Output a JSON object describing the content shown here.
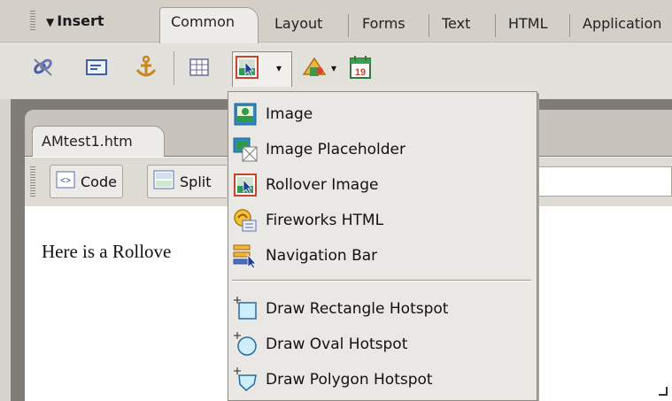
{
  "insert_bar": {
    "title": "Insert",
    "tabs": [
      "Common",
      "Layout",
      "Forms",
      "Text",
      "HTML",
      "Application"
    ],
    "active_tab": "Common",
    "date_icon_number": "19"
  },
  "document": {
    "tab_title": "AMtest1.htm",
    "view_buttons": {
      "code": "Code",
      "split": "Split"
    },
    "body_text": "Here is a Rollove"
  },
  "menu": {
    "items": [
      {
        "label": "Image",
        "icon": "image-icon"
      },
      {
        "label": "Image Placeholder",
        "icon": "image-placeholder-icon"
      },
      {
        "label": "Rollover Image",
        "icon": "rollover-image-icon"
      },
      {
        "label": "Fireworks HTML",
        "icon": "fireworks-html-icon"
      },
      {
        "label": "Navigation Bar",
        "icon": "navigation-bar-icon"
      },
      {
        "label": "Draw Rectangle Hotspot",
        "icon": "rectangle-hotspot-icon"
      },
      {
        "label": "Draw Oval Hotspot",
        "icon": "oval-hotspot-icon"
      },
      {
        "label": "Draw Polygon Hotspot",
        "icon": "polygon-hotspot-icon"
      }
    ]
  }
}
